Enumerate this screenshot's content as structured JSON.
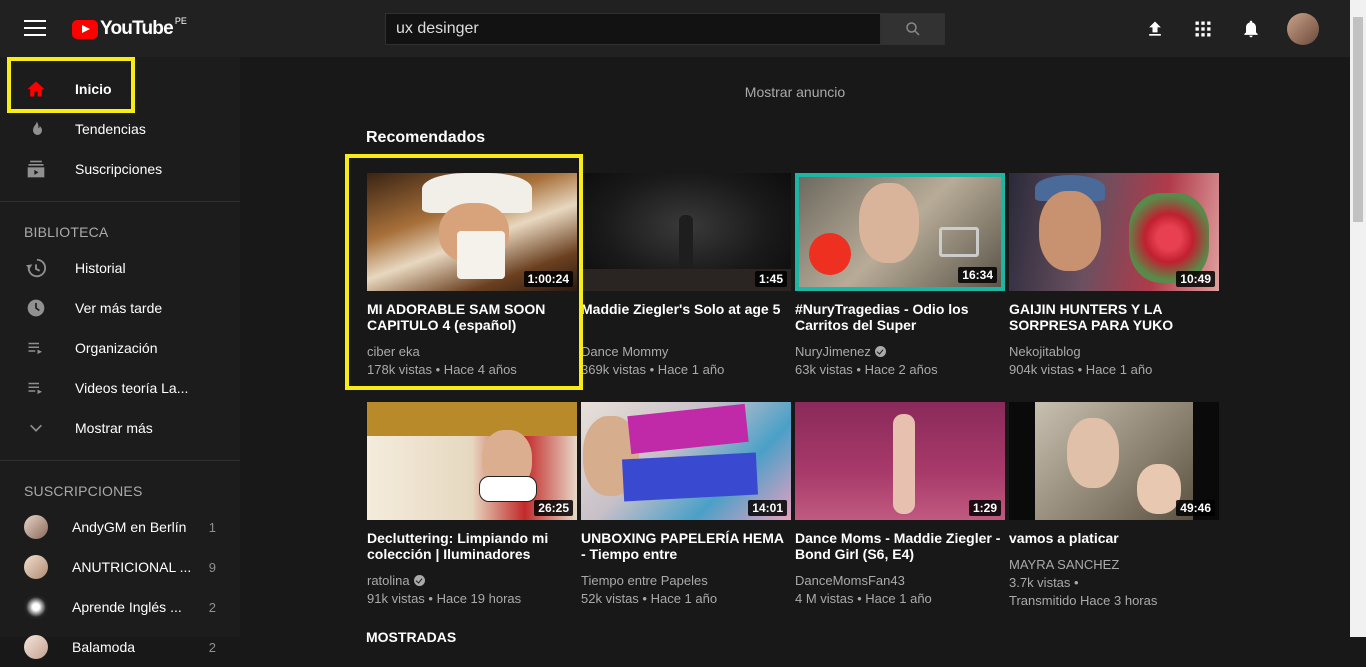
{
  "header": {
    "logo_text": "YouTube",
    "country": "PE",
    "search_value": "ux desinger"
  },
  "sidebar": {
    "main": [
      {
        "label": "Inicio",
        "icon": "home-icon"
      },
      {
        "label": "Tendencias",
        "icon": "flame-icon"
      },
      {
        "label": "Suscripciones",
        "icon": "subscriptions-icon"
      }
    ],
    "library_title": "BIBLIOTECA",
    "library": [
      {
        "label": "Historial",
        "icon": "history-icon"
      },
      {
        "label": "Ver más tarde",
        "icon": "clock-icon"
      },
      {
        "label": "Organización",
        "icon": "playlist-icon"
      },
      {
        "label": "Videos teoría La...",
        "icon": "playlist-icon"
      },
      {
        "label": "Mostrar más",
        "icon": "chevron-down-icon"
      }
    ],
    "subs_title": "SUSCRIPCIONES",
    "subs": [
      {
        "label": "AndyGM en Berlín",
        "count": "1"
      },
      {
        "label": "ANUTRICIONAL ...",
        "count": "9"
      },
      {
        "label": "Aprende Inglés ...",
        "count": "2"
      },
      {
        "label": "Balamoda",
        "count": "2"
      }
    ]
  },
  "main": {
    "ad_text": "Mostrar anuncio",
    "section_title": "Recomendados",
    "next_section": "MOSTRADAS",
    "videos": [
      {
        "title": "MI ADORABLE SAM SOON CAPITULO 4 (español)",
        "channel": "ciber eka",
        "verified": false,
        "meta": "178k vistas • Hace 4 años",
        "meta2": "",
        "duration": "1:00:24"
      },
      {
        "title": "Maddie Ziegler's Solo at age 5",
        "channel": "Dance Mommy",
        "verified": false,
        "meta": "369k vistas • Hace 1 año",
        "meta2": "",
        "duration": "1:45"
      },
      {
        "title": "#NuryTragedias - Odio los Carritos del Super",
        "channel": "NuryJimenez",
        "verified": true,
        "meta": "63k vistas • Hace 2 años",
        "meta2": "",
        "duration": "16:34"
      },
      {
        "title": "GAIJIN HUNTERS Y LA SORPRESA PARA YUKO",
        "channel": "Nekojitablog",
        "verified": false,
        "meta": "904k vistas • Hace 1 año",
        "meta2": "",
        "duration": "10:49"
      },
      {
        "title": "Decluttering: Limpiando mi colección | Iluminadores",
        "channel": "ratolina",
        "verified": true,
        "meta": "91k vistas • Hace 19 horas",
        "meta2": "",
        "duration": "26:25"
      },
      {
        "title": "UNBOXING PAPELERÍA HEMA - Tiempo entre",
        "channel": "Tiempo entre Papeles",
        "verified": false,
        "meta": "52k vistas • Hace 1 año",
        "meta2": "",
        "duration": "14:01"
      },
      {
        "title": "Dance Moms - Maddie Ziegler - Bond Girl (S6, E4)",
        "channel": "DanceMomsFan43",
        "verified": false,
        "meta": "4 M vistas • Hace 1 año",
        "meta2": "",
        "duration": "1:29"
      },
      {
        "title": "vamos a platicar",
        "channel": "MAYRA SANCHEZ",
        "verified": false,
        "meta": "3.7k vistas •",
        "meta2": "Transmitido Hace 3 horas",
        "duration": "49:46"
      }
    ]
  },
  "colors": {
    "brand_red": "#ff0000",
    "highlight": "#f7ec14",
    "background": "#181818",
    "sidebar": "#1c1c1c",
    "topbar": "#212121"
  }
}
